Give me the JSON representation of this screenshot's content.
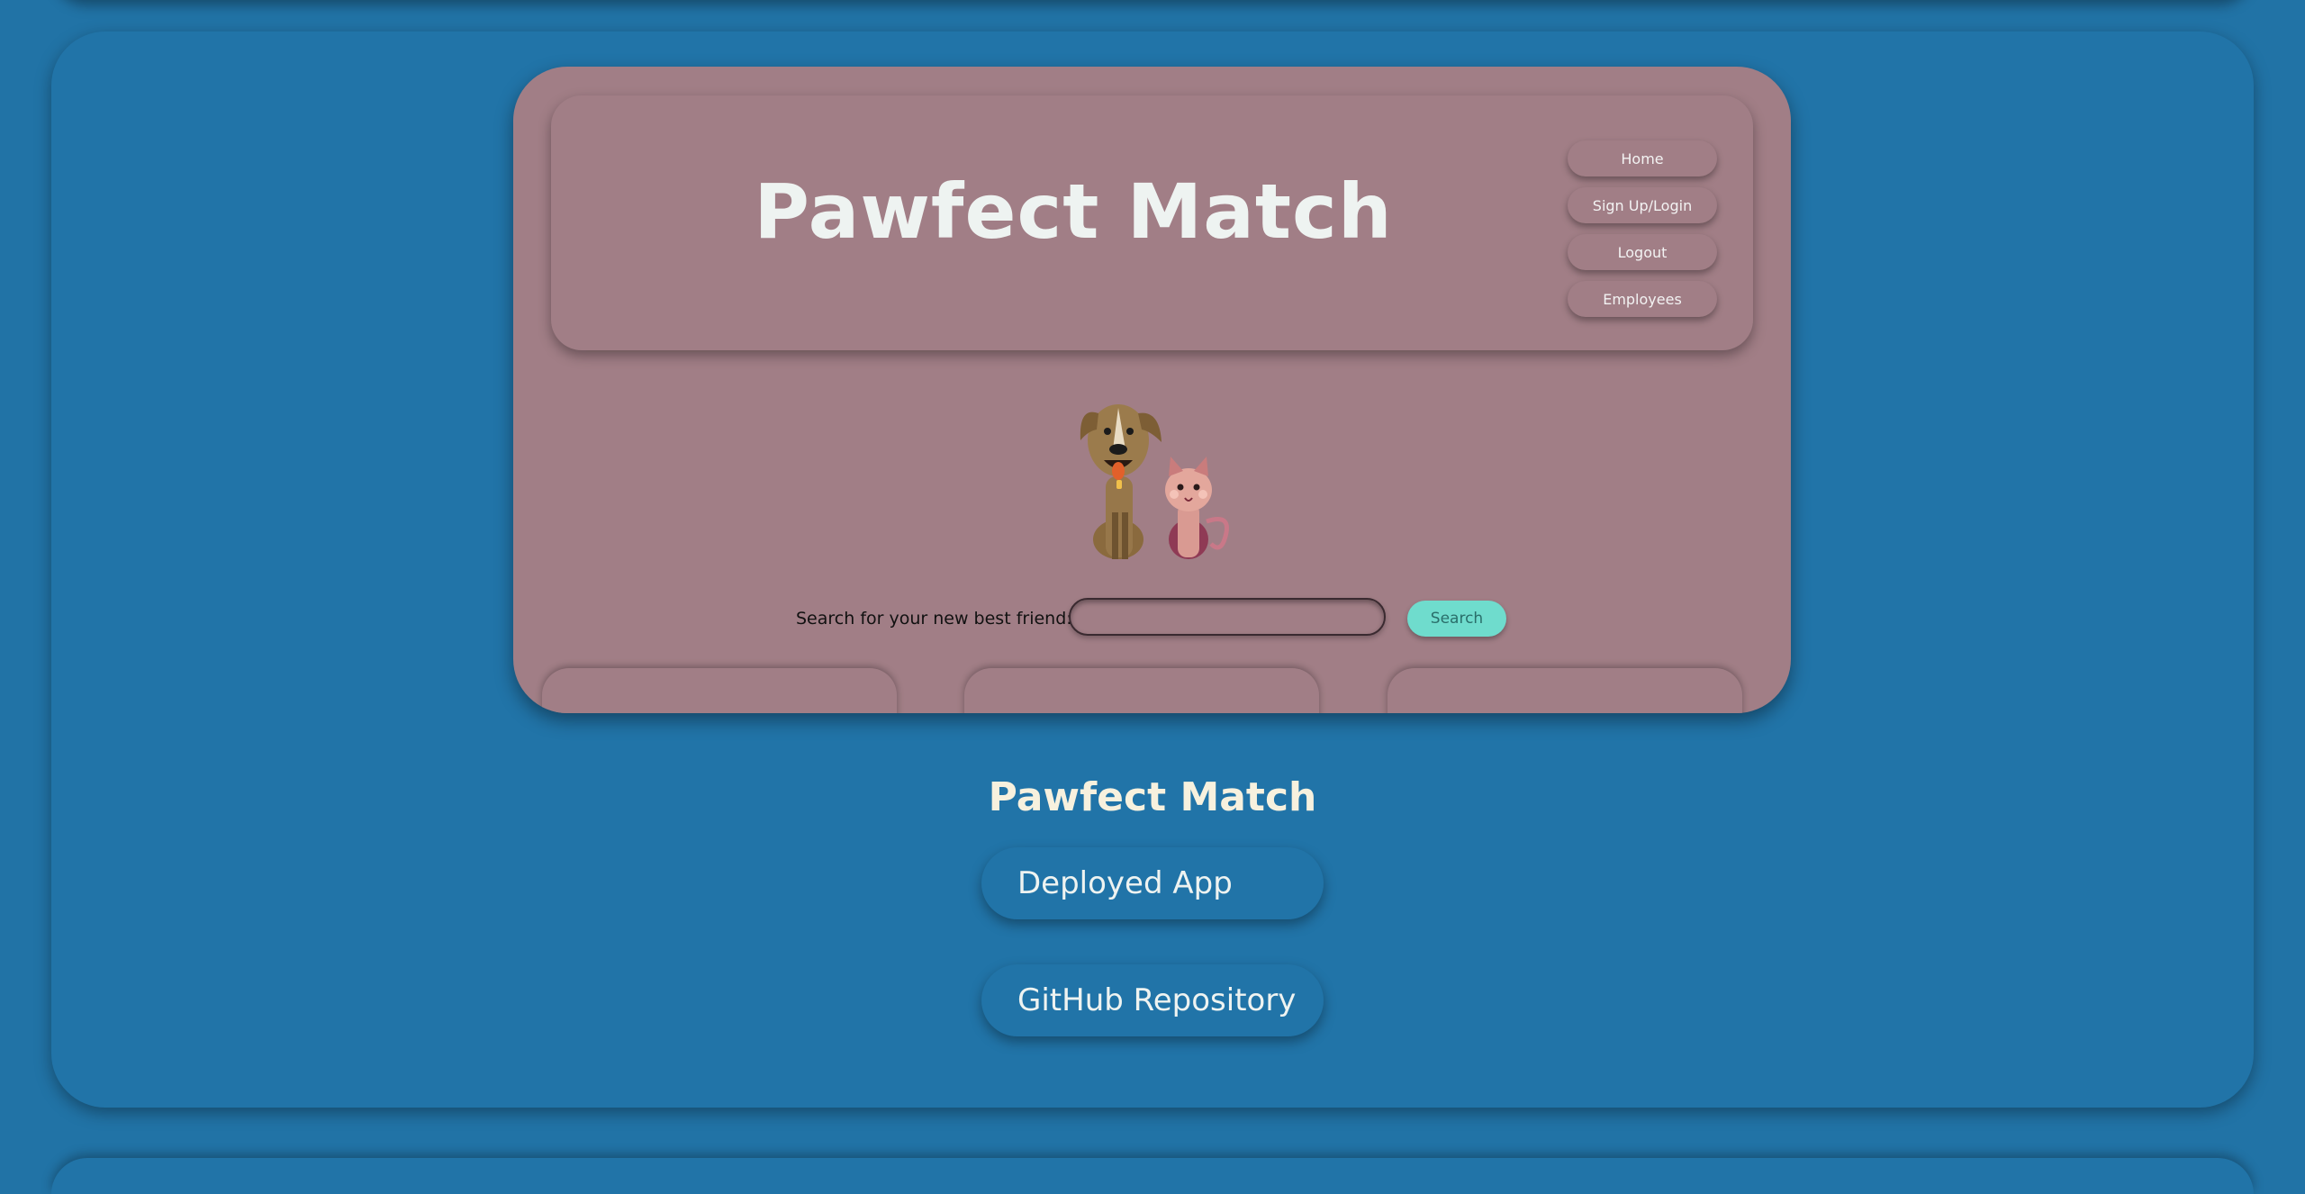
{
  "preview": {
    "site_title": "Pawfect Match",
    "nav": [
      "Home",
      "Sign Up/Login",
      "Logout",
      "Employees"
    ],
    "search": {
      "label": "Search for your new best friend:",
      "value": "",
      "button": "Search"
    },
    "illustration": "dog-and-cat-illustration"
  },
  "project": {
    "title": "Pawfect Match",
    "links": [
      "Deployed App",
      "GitHub Repository"
    ]
  },
  "colors": {
    "page_bg": "#2173a6",
    "preview_bg": "#a17e86",
    "search_button": "#6fdccd",
    "project_title": "#f7f1de"
  }
}
